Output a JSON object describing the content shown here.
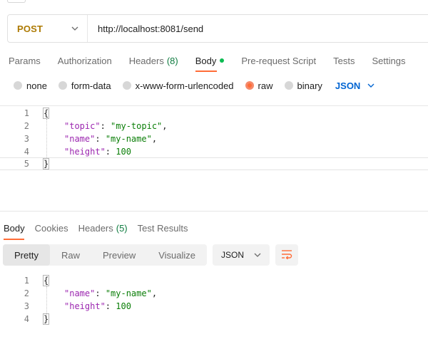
{
  "request": {
    "method": "POST",
    "url": "http://localhost:8081/send",
    "tabs": [
      {
        "label": "Params"
      },
      {
        "label": "Authorization"
      },
      {
        "label": "Headers",
        "count": "(8)"
      },
      {
        "label": "Body",
        "active": true
      },
      {
        "label": "Pre-request Script"
      },
      {
        "label": "Tests"
      },
      {
        "label": "Settings"
      }
    ],
    "body_types": [
      "none",
      "form-data",
      "x-www-form-urlencoded",
      "raw",
      "binary"
    ],
    "selected_body_type": "raw",
    "format": "JSON",
    "editor": {
      "line_numbers": [
        "1",
        "2",
        "3",
        "4",
        "5"
      ],
      "lines": [
        "{",
        "\"topic\": \"my-topic\",",
        "\"name\": \"my-name\",",
        "\"height\": 100",
        "}"
      ]
    }
  },
  "response": {
    "tabs": [
      {
        "label": "Body",
        "active": true
      },
      {
        "label": "Cookies"
      },
      {
        "label": "Headers",
        "count": "(5)"
      },
      {
        "label": "Test Results"
      }
    ],
    "view_modes": [
      "Pretty",
      "Raw",
      "Preview",
      "Visualize"
    ],
    "active_view": "Pretty",
    "format": "JSON",
    "editor": {
      "line_numbers": [
        "1",
        "2",
        "3",
        "4"
      ],
      "lines": [
        "{",
        "\"name\": \"my-name\",",
        "\"height\": 100",
        "}"
      ]
    }
  },
  "colors": {
    "accent": "#ff6c37",
    "method_post": "#ad7a03",
    "link_blue": "#0265d2",
    "count_green": "#107c41",
    "status_dot": "#0cbb52"
  },
  "icons": {
    "method_chevron": "chevron-down-icon",
    "format_chevron": "chevron-down-icon",
    "wrap": "wrap-lines-icon"
  }
}
